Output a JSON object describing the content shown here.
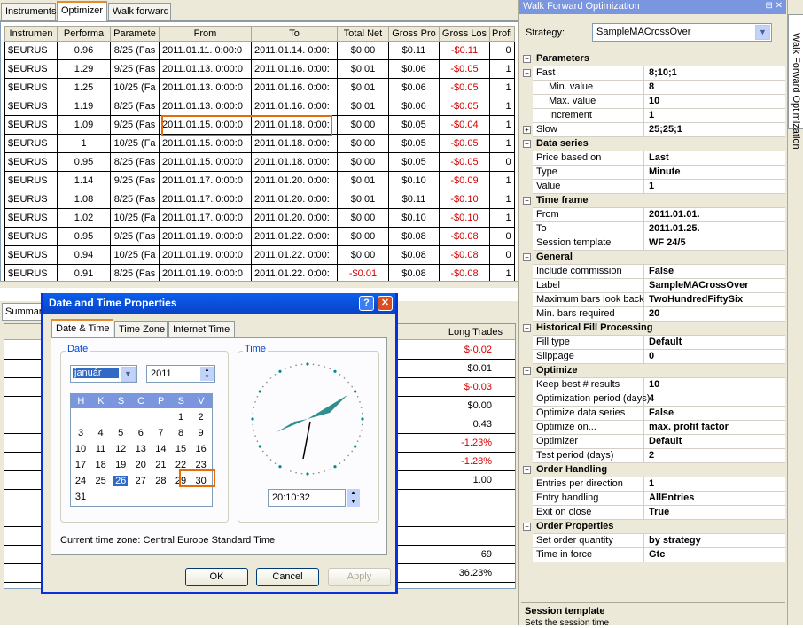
{
  "tabs": [
    "Instruments",
    "Optimizer",
    "Walk forward"
  ],
  "grid": {
    "headers": [
      "Instrumen",
      "Performa",
      "Paramete",
      "From",
      "To",
      "Total Net",
      "Gross Pro",
      "Gross Los",
      "Profi"
    ],
    "rows": [
      [
        "$EURUS",
        "0.96",
        "8/25 (Fas",
        "2011.01.11. 0:00:0",
        "2011.01.14. 0:00:",
        "$0.00",
        "$0.11",
        "-$0.11",
        "0"
      ],
      [
        "$EURUS",
        "1.29",
        "9/25 (Fas",
        "2011.01.13. 0:00:0",
        "2011.01.16. 0:00:",
        "$0.01",
        "$0.06",
        "-$0.05",
        "1"
      ],
      [
        "$EURUS",
        "1.25",
        "10/25 (Fa",
        "2011.01.13. 0:00:0",
        "2011.01.16. 0:00:",
        "$0.01",
        "$0.06",
        "-$0.05",
        "1"
      ],
      [
        "$EURUS",
        "1.19",
        "8/25 (Fas",
        "2011.01.13. 0:00:0",
        "2011.01.16. 0:00:",
        "$0.01",
        "$0.06",
        "-$0.05",
        "1"
      ],
      [
        "$EURUS",
        "1.09",
        "9/25 (Fas",
        "2011.01.15. 0:00:0",
        "2011.01.18. 0:00:",
        "$0.00",
        "$0.05",
        "-$0.04",
        "1"
      ],
      [
        "$EURUS",
        "1",
        "10/25 (Fa",
        "2011.01.15. 0:00:0",
        "2011.01.18. 0:00:",
        "$0.00",
        "$0.05",
        "-$0.05",
        "1"
      ],
      [
        "$EURUS",
        "0.95",
        "8/25 (Fas",
        "2011.01.15. 0:00:0",
        "2011.01.18. 0:00:",
        "$0.00",
        "$0.05",
        "-$0.05",
        "0"
      ],
      [
        "$EURUS",
        "1.14",
        "9/25 (Fas",
        "2011.01.17. 0:00:0",
        "2011.01.20. 0:00:",
        "$0.01",
        "$0.10",
        "-$0.09",
        "1"
      ],
      [
        "$EURUS",
        "1.08",
        "8/25 (Fas",
        "2011.01.17. 0:00:0",
        "2011.01.20. 0:00:",
        "$0.01",
        "$0.11",
        "-$0.10",
        "1"
      ],
      [
        "$EURUS",
        "1.02",
        "10/25 (Fa",
        "2011.01.17. 0:00:0",
        "2011.01.20. 0:00:",
        "$0.00",
        "$0.10",
        "-$0.10",
        "1"
      ],
      [
        "$EURUS",
        "0.95",
        "9/25 (Fas",
        "2011.01.19. 0:00:0",
        "2011.01.22. 0:00:",
        "$0.00",
        "$0.08",
        "-$0.08",
        "0"
      ],
      [
        "$EURUS",
        "0.94",
        "10/25 (Fa",
        "2011.01.19. 0:00:0",
        "2011.01.22. 0:00:",
        "$0.00",
        "$0.08",
        "-$0.08",
        "0"
      ],
      [
        "$EURUS",
        "0.91",
        "8/25 (Fas",
        "2011.01.19. 0:00:0",
        "2011.01.22. 0:00:",
        "-$0.01",
        "$0.08",
        "-$0.08",
        "1"
      ]
    ]
  },
  "summary": {
    "tab": "Summar",
    "header": "Long Trades",
    "values": [
      "$-0.02",
      "$0.01",
      "$-0.03",
      "$0.00",
      "0.43",
      "-1.23%",
      "-1.28%",
      "1.00",
      "",
      "",
      "",
      "69",
      "36.23%"
    ]
  },
  "right_panel": {
    "title": "Walk Forward Optimization",
    "strategy_label": "Strategy:",
    "strategy_value": "SampleMACrossOver",
    "vertical_tab": "Walk Forward Optimization",
    "rows": [
      {
        "kind": "cat",
        "name": "Parameters",
        "exp": "−"
      },
      {
        "kind": "item",
        "name": "Fast",
        "value": "8;10;1",
        "exp": "−"
      },
      {
        "kind": "sub",
        "name": "Min. value",
        "value": "8"
      },
      {
        "kind": "sub",
        "name": "Max. value",
        "value": "10"
      },
      {
        "kind": "sub",
        "name": "Increment",
        "value": "1"
      },
      {
        "kind": "item",
        "name": "Slow",
        "value": "25;25;1",
        "exp": "+"
      },
      {
        "kind": "cat",
        "name": "Data series",
        "exp": "−"
      },
      {
        "kind": "item",
        "name": "Price based on",
        "value": "Last"
      },
      {
        "kind": "item",
        "name": "Type",
        "value": "Minute"
      },
      {
        "kind": "item",
        "name": "Value",
        "value": "1"
      },
      {
        "kind": "cat",
        "name": "Time frame",
        "exp": "−"
      },
      {
        "kind": "item",
        "name": "From",
        "value": "2011.01.01."
      },
      {
        "kind": "item",
        "name": "To",
        "value": "2011.01.25."
      },
      {
        "kind": "item",
        "name": "Session template",
        "value": "WF 24/5"
      },
      {
        "kind": "cat",
        "name": "General",
        "exp": "−"
      },
      {
        "kind": "item",
        "name": "Include commission",
        "value": "False"
      },
      {
        "kind": "item",
        "name": "Label",
        "value": "SampleMACrossOver"
      },
      {
        "kind": "item",
        "name": "Maximum bars look back",
        "value": "TwoHundredFiftySix"
      },
      {
        "kind": "item",
        "name": "Min. bars required",
        "value": "20"
      },
      {
        "kind": "cat",
        "name": "Historical Fill Processing",
        "exp": "−"
      },
      {
        "kind": "item",
        "name": "Fill type",
        "value": "Default"
      },
      {
        "kind": "item",
        "name": "Slippage",
        "value": "0"
      },
      {
        "kind": "cat",
        "name": "Optimize",
        "exp": "−"
      },
      {
        "kind": "item",
        "name": "Keep best # results",
        "value": "10"
      },
      {
        "kind": "item",
        "name": "Optimization period (days)",
        "value": "4"
      },
      {
        "kind": "item",
        "name": "Optimize data series",
        "value": "False"
      },
      {
        "kind": "item",
        "name": "Optimize on...",
        "value": "max. profit factor"
      },
      {
        "kind": "item",
        "name": "Optimizer",
        "value": "Default"
      },
      {
        "kind": "item",
        "name": "Test period (days)",
        "value": "2"
      },
      {
        "kind": "cat",
        "name": "Order Handling",
        "exp": "−"
      },
      {
        "kind": "item",
        "name": "Entries per direction",
        "value": "1"
      },
      {
        "kind": "item",
        "name": "Entry handling",
        "value": "AllEntries"
      },
      {
        "kind": "item",
        "name": "Exit on close",
        "value": "True"
      },
      {
        "kind": "cat",
        "name": "Order Properties",
        "exp": "−"
      },
      {
        "kind": "item",
        "name": "Set order quantity",
        "value": "by strategy"
      },
      {
        "kind": "item",
        "name": "Time in force",
        "value": "Gtc"
      }
    ],
    "desc_title": "Session template",
    "desc_text": "Sets the session time"
  },
  "dialog": {
    "title": "Date and Time Properties",
    "tabs": [
      "Date & Time",
      "Time Zone",
      "Internet Time"
    ],
    "date_group": "Date",
    "time_group": "Time",
    "month": "január",
    "year": "2011",
    "weekdays": [
      "H",
      "K",
      "S",
      "C",
      "P",
      "S",
      "V"
    ],
    "days": [
      [
        "",
        "",
        "",
        "",
        "",
        "1",
        "2"
      ],
      [
        "3",
        "4",
        "5",
        "6",
        "7",
        "8",
        "9"
      ],
      [
        "10",
        "11",
        "12",
        "13",
        "14",
        "15",
        "16"
      ],
      [
        "17",
        "18",
        "19",
        "20",
        "21",
        "22",
        "23"
      ],
      [
        "24",
        "25",
        "26",
        "27",
        "28",
        "29",
        "30"
      ],
      [
        "31",
        "",
        "",
        "",
        "",
        "",
        ""
      ]
    ],
    "selected_day": "26",
    "time_value": "20:10:32",
    "timezone_text": "Current time zone:  Central Europe Standard Time",
    "ok": "OK",
    "cancel": "Cancel",
    "apply": "Apply",
    "help_glyph": "?",
    "close_glyph": "✕"
  },
  "colors": {
    "negative": "#d40000",
    "highlight": "#e46c0a",
    "xp_blue": "#0842c6"
  }
}
